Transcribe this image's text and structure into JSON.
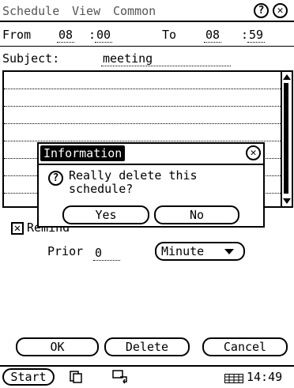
{
  "menu": {
    "items": [
      "Schedule",
      "View",
      "Common"
    ],
    "help_icon": "question-icon",
    "close_icon": "close-icon"
  },
  "time_row": {
    "from_label": "From",
    "from_hour": "08",
    "from_sep": ":",
    "from_minute": "00",
    "to_label": "To",
    "to_hour": "08",
    "to_sep": ":",
    "to_minute": "59"
  },
  "subject": {
    "label": "Subject:",
    "value": "meeting"
  },
  "dialog": {
    "title": "Information",
    "message_line1": "Really delete this",
    "message_line2": "schedule?",
    "yes_label": "Yes",
    "no_label": "No"
  },
  "remind": {
    "label": "Remind",
    "checked": true,
    "prior_label": "Prior",
    "prior_value": "0",
    "unit_selected": "Minute"
  },
  "actions": {
    "ok_label": "OK",
    "delete_label": "Delete",
    "cancel_label": "Cancel"
  },
  "taskbar": {
    "start_label": "Start",
    "clock": "14:49"
  }
}
